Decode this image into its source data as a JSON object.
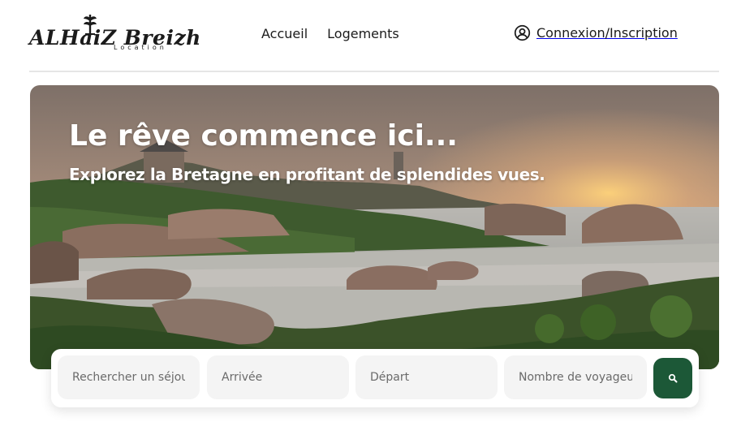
{
  "brand": {
    "name": "ALHaiZ Breizh",
    "tagline": "Location"
  },
  "nav": {
    "items": [
      {
        "label": "Accueil"
      },
      {
        "label": "Logements"
      }
    ]
  },
  "account": {
    "label": "Connexion/Inscription",
    "icon": "user-circle-icon"
  },
  "hero": {
    "title": "Le rêve commence ici...",
    "subtitle": "Explorez la Bretagne en profitant de splendides vues."
  },
  "search": {
    "destination_placeholder": "Rechercher un séjour",
    "arrival_placeholder": "Arrivée",
    "departure_placeholder": "Départ",
    "guests_placeholder": "Nombre de voyageurs",
    "button_icon": "search-icon"
  },
  "colors": {
    "accent": "#1c5837",
    "text": "#1b1b1b",
    "field_bg": "#f4f4f4"
  }
}
